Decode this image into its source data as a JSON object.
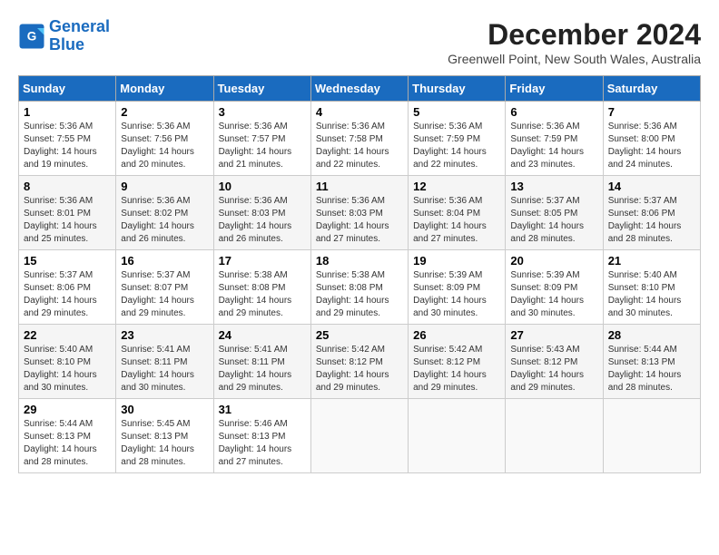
{
  "logo": {
    "line1": "General",
    "line2": "Blue"
  },
  "title": "December 2024",
  "subtitle": "Greenwell Point, New South Wales, Australia",
  "days_of_week": [
    "Sunday",
    "Monday",
    "Tuesday",
    "Wednesday",
    "Thursday",
    "Friday",
    "Saturday"
  ],
  "weeks": [
    [
      {
        "day": "1",
        "sunrise": "5:36 AM",
        "sunset": "7:55 PM",
        "daylight": "14 hours and 19 minutes."
      },
      {
        "day": "2",
        "sunrise": "5:36 AM",
        "sunset": "7:56 PM",
        "daylight": "14 hours and 20 minutes."
      },
      {
        "day": "3",
        "sunrise": "5:36 AM",
        "sunset": "7:57 PM",
        "daylight": "14 hours and 21 minutes."
      },
      {
        "day": "4",
        "sunrise": "5:36 AM",
        "sunset": "7:58 PM",
        "daylight": "14 hours and 22 minutes."
      },
      {
        "day": "5",
        "sunrise": "5:36 AM",
        "sunset": "7:59 PM",
        "daylight": "14 hours and 22 minutes."
      },
      {
        "day": "6",
        "sunrise": "5:36 AM",
        "sunset": "7:59 PM",
        "daylight": "14 hours and 23 minutes."
      },
      {
        "day": "7",
        "sunrise": "5:36 AM",
        "sunset": "8:00 PM",
        "daylight": "14 hours and 24 minutes."
      }
    ],
    [
      {
        "day": "8",
        "sunrise": "5:36 AM",
        "sunset": "8:01 PM",
        "daylight": "14 hours and 25 minutes."
      },
      {
        "day": "9",
        "sunrise": "5:36 AM",
        "sunset": "8:02 PM",
        "daylight": "14 hours and 26 minutes."
      },
      {
        "day": "10",
        "sunrise": "5:36 AM",
        "sunset": "8:03 PM",
        "daylight": "14 hours and 26 minutes."
      },
      {
        "day": "11",
        "sunrise": "5:36 AM",
        "sunset": "8:03 PM",
        "daylight": "14 hours and 27 minutes."
      },
      {
        "day": "12",
        "sunrise": "5:36 AM",
        "sunset": "8:04 PM",
        "daylight": "14 hours and 27 minutes."
      },
      {
        "day": "13",
        "sunrise": "5:37 AM",
        "sunset": "8:05 PM",
        "daylight": "14 hours and 28 minutes."
      },
      {
        "day": "14",
        "sunrise": "5:37 AM",
        "sunset": "8:06 PM",
        "daylight": "14 hours and 28 minutes."
      }
    ],
    [
      {
        "day": "15",
        "sunrise": "5:37 AM",
        "sunset": "8:06 PM",
        "daylight": "14 hours and 29 minutes."
      },
      {
        "day": "16",
        "sunrise": "5:37 AM",
        "sunset": "8:07 PM",
        "daylight": "14 hours and 29 minutes."
      },
      {
        "day": "17",
        "sunrise": "5:38 AM",
        "sunset": "8:08 PM",
        "daylight": "14 hours and 29 minutes."
      },
      {
        "day": "18",
        "sunrise": "5:38 AM",
        "sunset": "8:08 PM",
        "daylight": "14 hours and 29 minutes."
      },
      {
        "day": "19",
        "sunrise": "5:39 AM",
        "sunset": "8:09 PM",
        "daylight": "14 hours and 30 minutes."
      },
      {
        "day": "20",
        "sunrise": "5:39 AM",
        "sunset": "8:09 PM",
        "daylight": "14 hours and 30 minutes."
      },
      {
        "day": "21",
        "sunrise": "5:40 AM",
        "sunset": "8:10 PM",
        "daylight": "14 hours and 30 minutes."
      }
    ],
    [
      {
        "day": "22",
        "sunrise": "5:40 AM",
        "sunset": "8:10 PM",
        "daylight": "14 hours and 30 minutes."
      },
      {
        "day": "23",
        "sunrise": "5:41 AM",
        "sunset": "8:11 PM",
        "daylight": "14 hours and 30 minutes."
      },
      {
        "day": "24",
        "sunrise": "5:41 AM",
        "sunset": "8:11 PM",
        "daylight": "14 hours and 29 minutes."
      },
      {
        "day": "25",
        "sunrise": "5:42 AM",
        "sunset": "8:12 PM",
        "daylight": "14 hours and 29 minutes."
      },
      {
        "day": "26",
        "sunrise": "5:42 AM",
        "sunset": "8:12 PM",
        "daylight": "14 hours and 29 minutes."
      },
      {
        "day": "27",
        "sunrise": "5:43 AM",
        "sunset": "8:12 PM",
        "daylight": "14 hours and 29 minutes."
      },
      {
        "day": "28",
        "sunrise": "5:44 AM",
        "sunset": "8:13 PM",
        "daylight": "14 hours and 28 minutes."
      }
    ],
    [
      {
        "day": "29",
        "sunrise": "5:44 AM",
        "sunset": "8:13 PM",
        "daylight": "14 hours and 28 minutes."
      },
      {
        "day": "30",
        "sunrise": "5:45 AM",
        "sunset": "8:13 PM",
        "daylight": "14 hours and 28 minutes."
      },
      {
        "day": "31",
        "sunrise": "5:46 AM",
        "sunset": "8:13 PM",
        "daylight": "14 hours and 27 minutes."
      },
      null,
      null,
      null,
      null
    ]
  ],
  "labels": {
    "sunrise": "Sunrise: ",
    "sunset": "Sunset: ",
    "daylight": "Daylight: "
  }
}
